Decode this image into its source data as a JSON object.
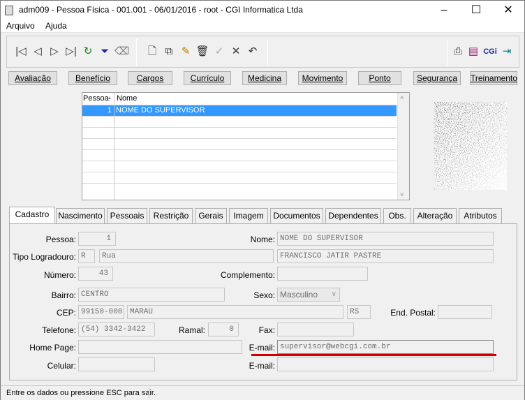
{
  "window": {
    "title": "adm009 - Pessoa Física - 001.001 - 06/01/2016 - root - CGI Informatica Ltda",
    "minimize": "–",
    "maximize": "☐",
    "close": "✕"
  },
  "menu": [
    "Arquivo",
    "Ajuda"
  ],
  "toolbar": {
    "first": "|◁",
    "prev": "◁",
    "next": "▷",
    "last": "▷|",
    "refresh": "↻",
    "filter": "⏷",
    "clear": "⌫",
    "new": "🗋",
    "copy": "⧉",
    "edit": "✎",
    "delete": "🗑",
    "confirm": "✓",
    "cancel": "✕",
    "undo": "↶",
    "print": "⎙",
    "book": "▤",
    "cgi": "CGi",
    "exit": "⇥"
  },
  "buttons": [
    "Avaliação",
    "Benefício",
    "Cargos",
    "Currículo",
    "Medicina",
    "Movimento",
    "Ponto",
    "Segurança",
    "Treinamento"
  ],
  "grid": {
    "headers": [
      "Pessoa",
      "Nome"
    ],
    "rows": [
      {
        "id": "1",
        "name": "NOME DO SUPERVISOR"
      }
    ]
  },
  "tabs": [
    "Cadastro",
    "Nascimento",
    "Pessoais",
    "Restrição",
    "Gerais",
    "Imagem",
    "Documentos",
    "Dependentes",
    "Obs.",
    "Alteração",
    "Atributos"
  ],
  "form": {
    "pessoa_label": "Pessoa:",
    "pessoa": "1",
    "nome_label": "Nome:",
    "nome": "NOME DO SUPERVISOR",
    "tipo_logradouro_label": "Tipo Logradouro:",
    "tipo_code": "R",
    "tipo_nome": "Rua",
    "logradouro": "FRANCISCO JATIR PASTRE",
    "numero_label": "Número:",
    "numero": "43",
    "complemento_label": "Complemento:",
    "complemento": "",
    "bairro_label": "Bairro:",
    "bairro": "CENTRO",
    "sexo_label": "Sexo:",
    "sexo": "Masculino",
    "cep_label": "CEP:",
    "cep": "99150-000",
    "cidade": "MARAU",
    "uf": "RS",
    "end_postal_label": "End. Postal:",
    "end_postal": "",
    "telefone_label": "Telefone:",
    "telefone": "(54) 3342-3422",
    "ramal_label": "Ramal:",
    "ramal": "0",
    "fax_label": "Fax:",
    "fax": "",
    "homepage_label": "Home Page:",
    "homepage": "",
    "email_label": "E-mail:",
    "email": "supervisor@webcgi.com.br",
    "celular_label": "Celular:",
    "celular": "",
    "email2_label": "E-mail:",
    "email2": ""
  },
  "status": "Entre os dados ou pressione ESC para sair.",
  "colors": {
    "selection": "#3399ff",
    "highlight": "#d40000"
  }
}
